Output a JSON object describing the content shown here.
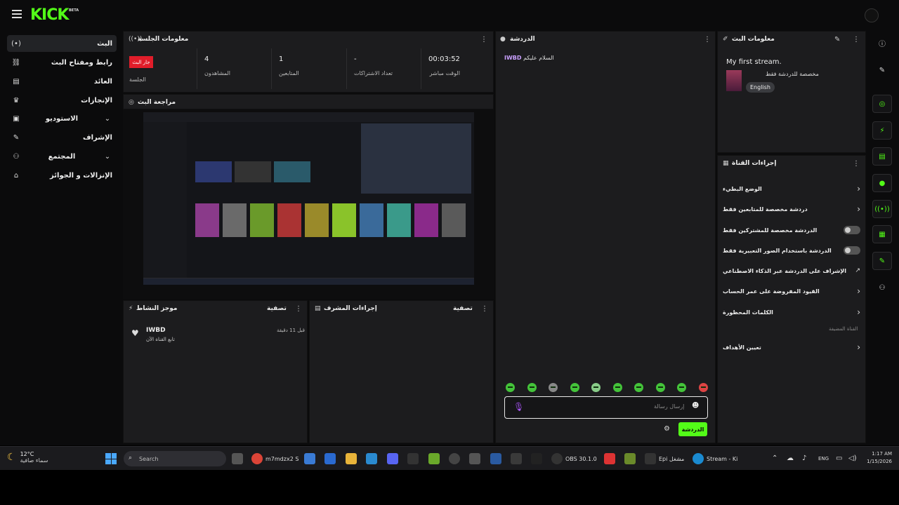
{
  "brand": {
    "logo": "KICK",
    "beta": "BETA"
  },
  "sidebar": {
    "items": [
      {
        "label": "البث",
        "icon": "broadcast-icon",
        "glyph": "(•)"
      },
      {
        "label": "رابط ومفتاح البث",
        "icon": "link-icon",
        "glyph": "⛓"
      },
      {
        "label": "العائد",
        "icon": "revenue-icon",
        "glyph": "▤"
      },
      {
        "label": "الإنجازات",
        "icon": "trophy-icon",
        "glyph": "🏆"
      },
      {
        "label": "الاستوديو",
        "icon": "studio-icon",
        "glyph": "▣"
      },
      {
        "label": "الإشراف",
        "icon": "wrench-icon",
        "glyph": "🔧"
      },
      {
        "label": "المجتمع",
        "icon": "community-icon",
        "glyph": "👥"
      },
      {
        "label": "الإنزالات و الجوائز",
        "icon": "drops-icon",
        "glyph": "⌂"
      }
    ]
  },
  "session": {
    "title": "معلومات الجلسة",
    "live_badge": "جار البث",
    "session_label": "الجلسة",
    "stats": [
      {
        "value": "4",
        "label": "المشاهدون"
      },
      {
        "value": "1",
        "label": "المتابعين"
      },
      {
        "value": "-",
        "label": "تعداد الاشتراكات"
      },
      {
        "value": "00:03:52",
        "label": "الوقت مباشر"
      }
    ]
  },
  "preview": {
    "title": "مراجعة البث"
  },
  "chat": {
    "title": "الدردشة",
    "message_user": "IWBD",
    "message_text": "السلام عليكم",
    "placeholder": "إرسال رسالة",
    "send_label": "الدردشة"
  },
  "stream_info": {
    "title": "معلومات البث",
    "stream_title": "My first stream.",
    "category": "مخصصة للدردشة فقط",
    "language": "English"
  },
  "channel_actions": {
    "title": "إجراءات القناة",
    "items": [
      {
        "label": "الوضع البطيء",
        "control": "chevron"
      },
      {
        "label": "دردشة مخصصة للمتابعين فقط",
        "control": "chevron"
      },
      {
        "label": "الدردشة مخصصة للمشتركين فقط",
        "control": "toggle"
      },
      {
        "label": "الدردشة باستخدام الصور التعبيرية فقط",
        "control": "toggle"
      },
      {
        "label": "الإشراف على الدردشة عبر الذكاء الاصطناعي",
        "control": "external"
      },
      {
        "label": "القيود المفروضة على عمر الحساب",
        "control": "chevron"
      },
      {
        "label": "الكلمات المحظورة",
        "control": "chevron"
      },
      {
        "label": "تعيين الأهداف",
        "control": "chevron"
      }
    ],
    "sub_label": "القناة المضيفة"
  },
  "activity": {
    "title": "موجز النشاط",
    "filter": "تصفية",
    "user": "IWBD",
    "desc": "تابع القناة الآن",
    "time": "قبل 11 دقيقة"
  },
  "mod_actions": {
    "title": "إجراءات المشرف",
    "filter": "تصفية"
  },
  "taskbar": {
    "temp": "12°C",
    "condition": "سماء صافية",
    "search": "Search",
    "apps": [
      {
        "label": "m7mdzx2 S"
      },
      {
        "label": "OBS 30.1.0"
      },
      {
        "label": "Epi مشغل"
      },
      {
        "label": "Stream - Ki"
      }
    ],
    "lang": "ENG",
    "time": "1:17 AM",
    "date": "1/15/2026"
  },
  "colors": {
    "accent": "#53fc18",
    "live": "#e11d2a",
    "panel": "#1c1c1e"
  }
}
